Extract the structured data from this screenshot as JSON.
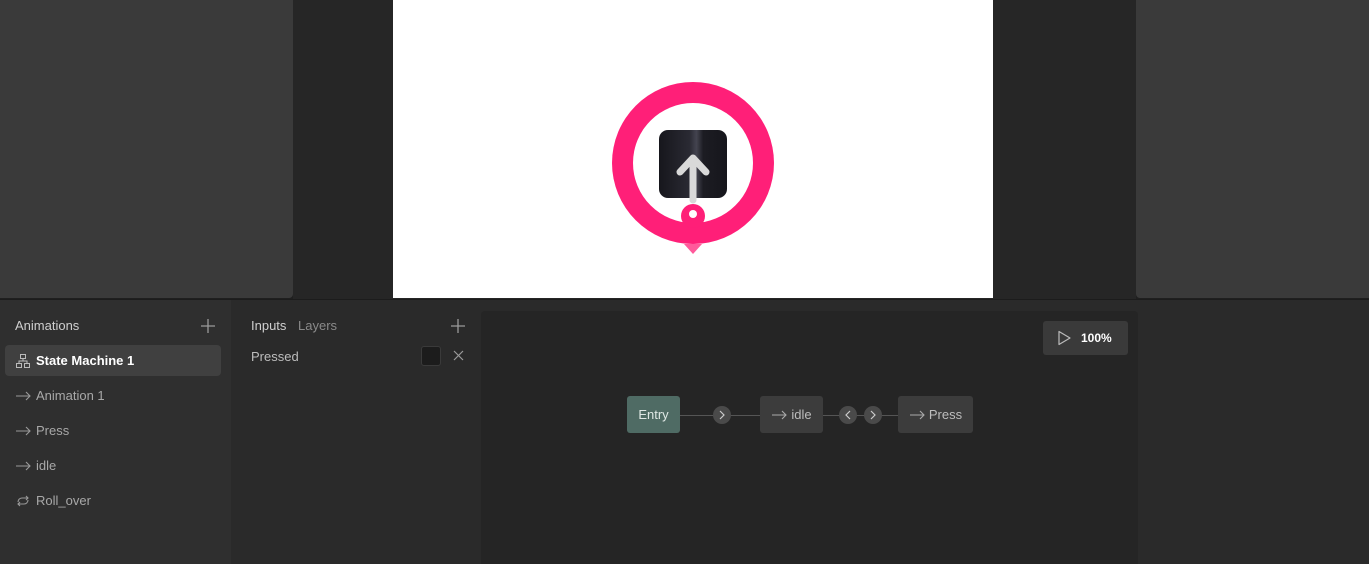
{
  "animations_panel": {
    "title": "Animations",
    "items": [
      {
        "label": "State Machine 1",
        "icon": "state-machine-icon",
        "selected": true
      },
      {
        "label": "Animation 1",
        "icon": "arrow-right-icon"
      },
      {
        "label": "Press",
        "icon": "arrow-right-icon"
      },
      {
        "label": "idle",
        "icon": "arrow-right-icon"
      },
      {
        "label": "Roll_over",
        "icon": "loop-icon"
      }
    ]
  },
  "inputs_panel": {
    "tab_inputs": "Inputs",
    "tab_layers": "Layers",
    "inputs": [
      {
        "label": "Pressed",
        "type": "boolean",
        "value": false
      }
    ]
  },
  "graph": {
    "zoom": "100%",
    "nodes": {
      "entry": "Entry",
      "idle": "idle",
      "press": "Press"
    }
  },
  "colors": {
    "accent": "#ff1f78",
    "entry_node": "#4f6b64",
    "artboard": "#ffffff"
  }
}
